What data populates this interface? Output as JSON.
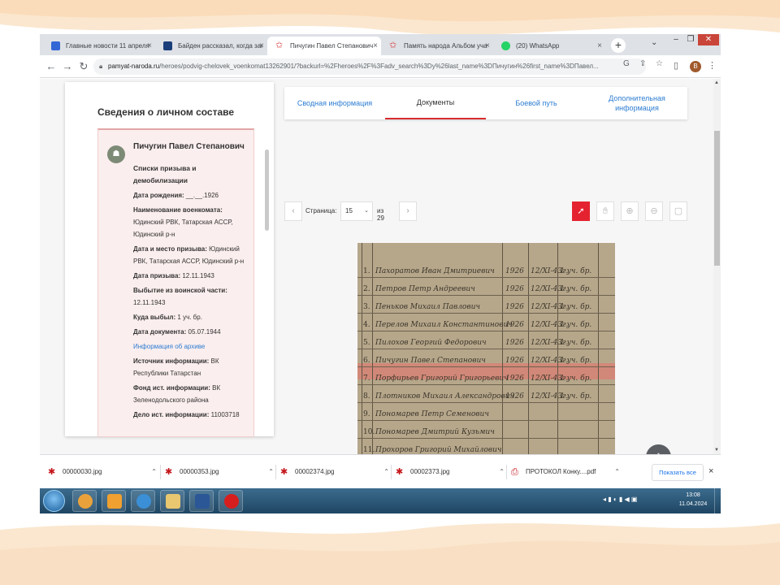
{
  "browser": {
    "tabs": [
      {
        "title": "Главные новости 11 апреля",
        "favicon_color": "#3367d6",
        "active": false
      },
      {
        "title": "Байден рассказал, когда закон",
        "favicon_color": "#1a3e7a",
        "active": false
      },
      {
        "title": "Пичугин Павел Степанович",
        "favicon_color": "#d62c2c",
        "active": true
      },
      {
        "title": "Память народа Альбом уча",
        "favicon_color": "#d62c2c",
        "active": false
      },
      {
        "title": "(20) WhatsApp",
        "favicon_color": "#25d366",
        "active": false
      }
    ],
    "new_tab": "+",
    "close_glyph": "×",
    "url_host": "pamyat-naroda.ru",
    "url_path": "/heroes/podvig-chelovek_voenkomat13262901/?backurl=%2Fheroes%2F%3Fadv_search%3Dy%26last_name%3DПичугин%26first_name%3DПавел...",
    "profile_initial": "В"
  },
  "page": {
    "side_title": "Сведения о личном составе",
    "person": {
      "name": "Пичугин Павел Степанович",
      "record_type": "Списки призыва и демобилизации",
      "fields": [
        {
          "label": "Дата рождения:",
          "value": "__.__.1926"
        },
        {
          "label": "Наименование военкомата:",
          "value": "Юдинский РВК, Татарская АССР, Юдинский р-н"
        },
        {
          "label": "Дата и место призыва:",
          "value": "Юдинский РВК, Татарская АССР, Юдинский р-н"
        },
        {
          "label": "Дата призыва:",
          "value": "12.11.1943"
        },
        {
          "label": "Выбытие из воинской части:",
          "value": "12.11.1943"
        },
        {
          "label": "Куда выбыл:",
          "value": "1 уч. бр."
        },
        {
          "label": "Дата документа:",
          "value": "05.07.1944"
        }
      ],
      "archive_link": "Информация об архиве",
      "source_fields": [
        {
          "label": "Источник информации:",
          "value": "ВК Республики Татарстан"
        },
        {
          "label": "Фонд ист. информации:",
          "value": "ВК Зеленодольского района"
        },
        {
          "label": "Дело ист. информации:",
          "value": "11003718"
        }
      ]
    },
    "doc_tabs": [
      "Сводная информация",
      "Документы",
      "Боевой путь",
      "Дополнительная информация"
    ],
    "active_doc_tab": 1,
    "pager": {
      "label": "Страница:",
      "current": "15",
      "of": "из 29",
      "prev": "‹",
      "next": "›"
    },
    "scan_rows": [
      {
        "n": "1.",
        "name": "Пахоратов Иван Дмитриевич",
        "year": "1926",
        "date": "12/XI-43г.",
        "unit": "1 уч. бр."
      },
      {
        "n": "2.",
        "name": "Петров Петр Андреевич",
        "year": "1926",
        "date": "12/XI-43г.",
        "unit": "1 уч. бр."
      },
      {
        "n": "3.",
        "name": "Пеньков Михаил Павлович",
        "year": "1926",
        "date": "12/XI-43г.",
        "unit": "1 уч. бр."
      },
      {
        "n": "4.",
        "name": "Перелов Михаил Константинович",
        "year": "1926",
        "date": "12/XI-43г.",
        "unit": "1 уч. бр."
      },
      {
        "n": "5.",
        "name": "Пилохов Георгий Федорович",
        "year": "1926",
        "date": "12/XI-43г.",
        "unit": "1 уч. бр."
      },
      {
        "n": "6.",
        "name": "Пичугин Павел Степанович",
        "year": "1926",
        "date": "12/XI-43г.",
        "unit": "1 уч. бр."
      },
      {
        "n": "7.",
        "name": "Порфирьев Григорий Григорьевич",
        "year": "1926",
        "date": "12/XI-43г.",
        "unit": "1 уч. бр."
      },
      {
        "n": "8.",
        "name": "Плотников Михаил Александрович",
        "year": "1926",
        "date": "12/XI-43г.",
        "unit": "1 уч. бр."
      },
      {
        "n": "9.",
        "name": "Пономарев Петр Семенович",
        "year": "",
        "date": "",
        "unit": ""
      },
      {
        "n": "10.",
        "name": "Пономарев Дмитрий Кузьмич",
        "year": "",
        "date": "",
        "unit": ""
      },
      {
        "n": "11.",
        "name": "Прохоров Григорий Михайлович",
        "year": "",
        "date": "",
        "unit": ""
      }
    ],
    "scroll_top": "^"
  },
  "downloads": {
    "items": [
      "00000030.jpg",
      "00000353.jpg",
      "00002374.jpg",
      "00002373.jpg",
      "ПРОТОКОЛ Конку....pdf"
    ],
    "show_all": "Показать все",
    "close": "×"
  },
  "taskbar": {
    "time": "13:08",
    "date": "11.04.2024",
    "apps": [
      {
        "name": "chrome",
        "color": "#e9a23b"
      },
      {
        "name": "media",
        "color": "#f0a030"
      },
      {
        "name": "ie",
        "color": "#3b8fd6"
      },
      {
        "name": "explorer",
        "color": "#e8c770"
      },
      {
        "name": "word",
        "color": "#2b5797"
      },
      {
        "name": "app",
        "color": "#d61e1e"
      }
    ]
  }
}
